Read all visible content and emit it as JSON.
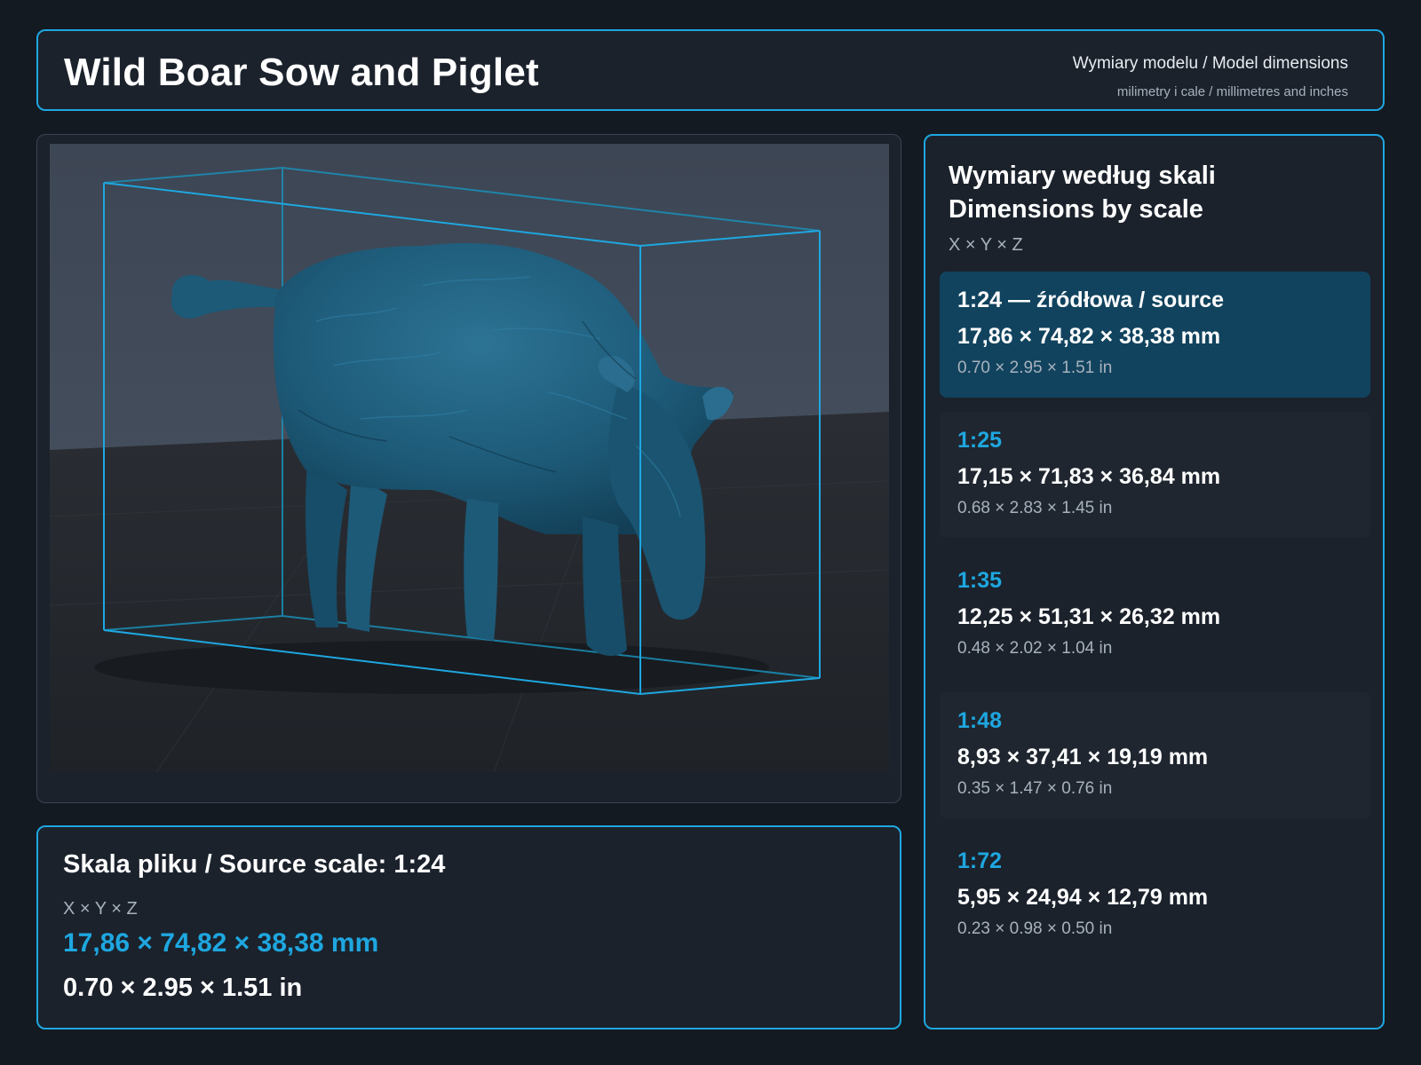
{
  "header": {
    "title": "Wild Boar Sow and Piglet",
    "subtitle": "Wymiary modelu / Model dimensions",
    "units_note": "milimetry i cale / millimetres and inches"
  },
  "viewer": {
    "model_color": "#1d5a78",
    "bbox_color": "#1ea7e0"
  },
  "source": {
    "title": "Skala pliku / Source scale: 1:24",
    "axes": "X × Y × Z",
    "mm": "17,86 × 74,82 × 38,38 mm",
    "inches": "0.70 × 2.95 × 1.51 in"
  },
  "scales_panel": {
    "title_pl": "Wymiary według skali",
    "title_en": "Dimensions by scale",
    "axes": "X × Y × Z",
    "items": [
      {
        "label": "1:24  —  źródłowa / source",
        "mm": "17,86 × 74,82 × 38,38 mm",
        "inches": "0.70 × 2.95 × 1.51 in"
      },
      {
        "label": "1:25",
        "mm": "17,15 × 71,83 × 36,84 mm",
        "inches": "0.68 × 2.83 × 1.45 in"
      },
      {
        "label": "1:35",
        "mm": "12,25 × 51,31 × 26,32 mm",
        "inches": "0.48 × 2.02 × 1.04 in"
      },
      {
        "label": "1:48",
        "mm": "8,93 × 37,41 × 19,19 mm",
        "inches": "0.35 × 1.47 × 0.76 in"
      },
      {
        "label": "1:72",
        "mm": "5,95 × 24,94 × 12,79 mm",
        "inches": "0.23 × 0.98 × 0.50 in"
      }
    ]
  }
}
